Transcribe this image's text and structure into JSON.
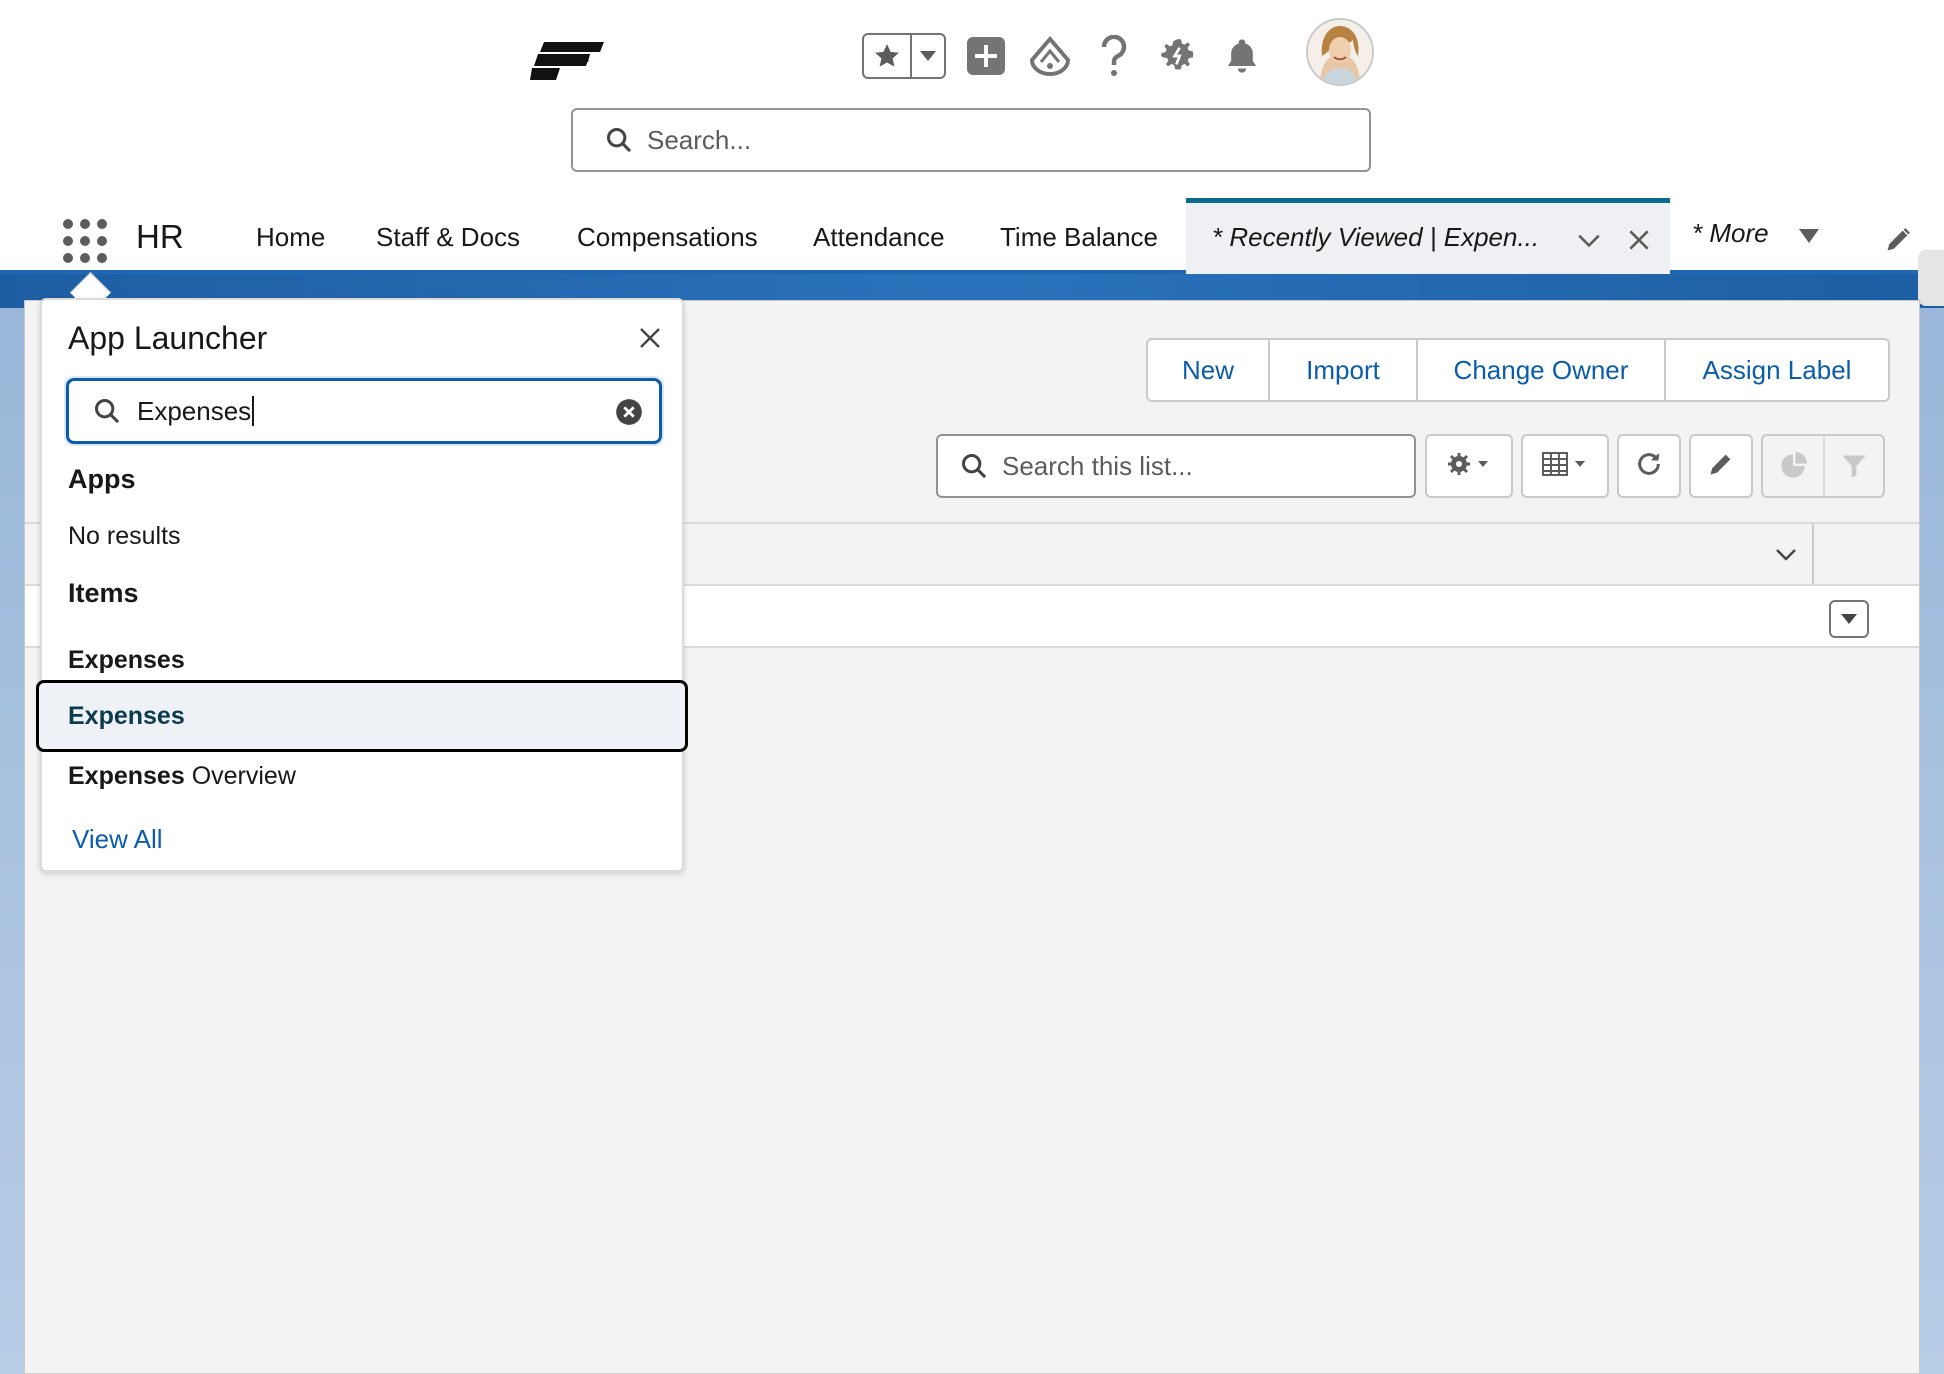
{
  "header": {
    "logo_icon": "company-logo",
    "utility_icons": [
      "star-icon",
      "chevron-down-icon",
      "plus-square-icon",
      "trailhead-icon",
      "help-icon",
      "setup-gear-icon",
      "bell-icon"
    ],
    "avatar": "user-avatar",
    "search_placeholder": "Search..."
  },
  "nav": {
    "app_name": "HR",
    "items": [
      "Home",
      "Staff & Docs",
      "Compensations",
      "Attendance",
      "Time Balance"
    ],
    "active_tab": "* Recently Viewed | Expen...",
    "more": "* More"
  },
  "toolbar": {
    "buttons": [
      "New",
      "Import",
      "Change Owner",
      "Assign Label"
    ],
    "list_search_placeholder": "Search this list..."
  },
  "launcher": {
    "title": "App Launcher",
    "search_value": "Expenses",
    "apps_heading": "Apps",
    "no_results": "No results",
    "items_heading": "Items",
    "items": [
      {
        "bold": "Expenses",
        "rest": ""
      },
      {
        "bold": "Expenses",
        "rest": ""
      },
      {
        "bold": "Expenses",
        "rest": " Overview"
      }
    ],
    "view_all": "View All"
  },
  "colors": {
    "brand_blue": "#0b5cab",
    "active_tab_border": "#0b6b8f",
    "nav_underline": "#1f68b3",
    "highlight_text": "#0c3b4d"
  }
}
